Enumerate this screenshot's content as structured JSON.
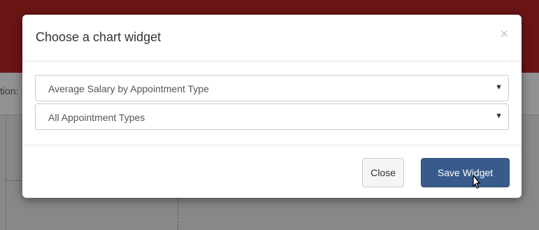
{
  "background": {
    "tab_fragment": "tion:"
  },
  "modal": {
    "title": "Choose a chart widget",
    "close_symbol": "×",
    "selects": [
      {
        "value": "Average Salary by Appointment Type",
        "caret": "▼"
      },
      {
        "value": "All Appointment Types",
        "caret": "▼"
      }
    ],
    "footer": {
      "close_label": "Close",
      "save_label": "Save Widget"
    }
  },
  "colors": {
    "header_bg": "#6b1515",
    "primary_button": "#385b8c",
    "overlay": "#848484"
  }
}
